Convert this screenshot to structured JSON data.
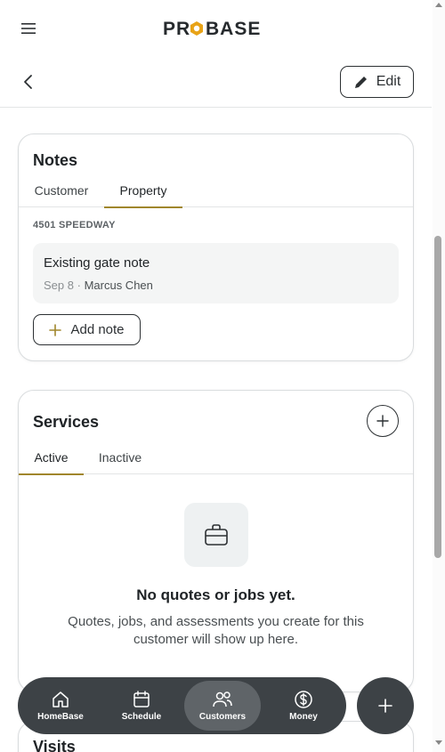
{
  "header": {
    "logo_text": "PROBASE",
    "menu_icon": "hamburger-icon"
  },
  "subheader": {
    "back_icon": "chevron-left-icon",
    "edit_label": "Edit"
  },
  "notes": {
    "title": "Notes",
    "tabs": [
      {
        "label": "Customer",
        "active": false
      },
      {
        "label": "Property",
        "active": true
      }
    ],
    "address": "4501 SPEEDWAY",
    "items": [
      {
        "text": "Existing gate note",
        "date": "Sep 8",
        "separator": "·",
        "author": "Marcus Chen"
      }
    ],
    "add_label": "Add note"
  },
  "services": {
    "title": "Services",
    "tabs": [
      {
        "label": "Active",
        "active": true
      },
      {
        "label": "Inactive",
        "active": false
      }
    ],
    "empty_title": "No quotes or jobs yet.",
    "empty_desc": "Quotes, jobs, and assessments you create for this customer will show up here."
  },
  "visits": {
    "title": "Visits"
  },
  "nav": {
    "items": [
      {
        "label": "HomeBase",
        "icon": "home-icon",
        "active": false
      },
      {
        "label": "Schedule",
        "icon": "calendar-icon",
        "active": false
      },
      {
        "label": "Customers",
        "icon": "users-icon",
        "active": true
      },
      {
        "label": "Money",
        "icon": "dollar-icon",
        "active": false
      }
    ]
  },
  "colors": {
    "accent": "#a0862c",
    "logo_orange": "#e8a317",
    "nav_bg": "#3d4246",
    "nav_active": "#5f6468"
  }
}
